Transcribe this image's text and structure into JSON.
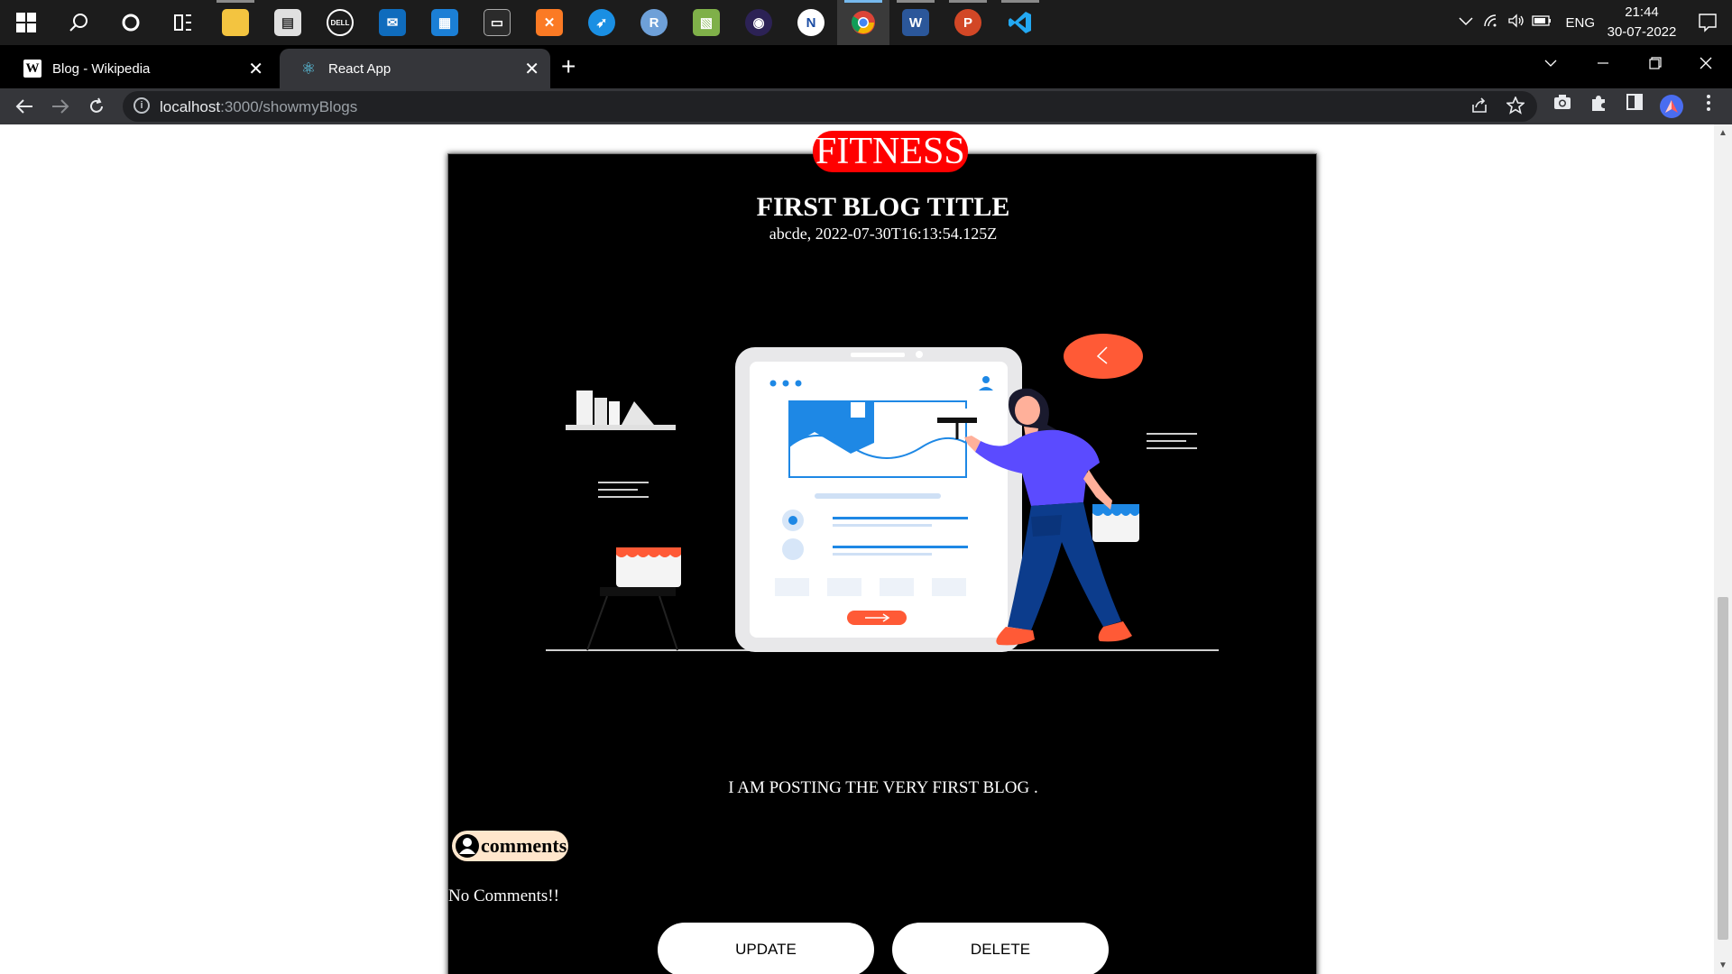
{
  "taskbar": {
    "apps": [
      {
        "name": "start",
        "glyph": "⊞"
      },
      {
        "name": "search",
        "glyph": "⚲"
      },
      {
        "name": "cortana",
        "glyph": "○"
      },
      {
        "name": "task-view",
        "glyph": "⧉"
      },
      {
        "name": "file-explorer",
        "glyph": "▬"
      },
      {
        "name": "document-app",
        "glyph": "▤"
      },
      {
        "name": "dell",
        "glyph": "DELL"
      },
      {
        "name": "mail",
        "glyph": "✉"
      },
      {
        "name": "store",
        "glyph": "▦"
      },
      {
        "name": "terminal",
        "glyph": "▭"
      },
      {
        "name": "xampp",
        "glyph": "✕"
      },
      {
        "name": "navigator",
        "glyph": "➶"
      },
      {
        "name": "r-app",
        "glyph": "R"
      },
      {
        "name": "image-app",
        "glyph": "▧"
      },
      {
        "name": "eclipse",
        "glyph": "◉"
      },
      {
        "name": "notes-app",
        "glyph": "N"
      },
      {
        "name": "chrome",
        "glyph": "●"
      },
      {
        "name": "word",
        "glyph": "W"
      },
      {
        "name": "powerpoint",
        "glyph": "P"
      },
      {
        "name": "vscode",
        "glyph": "⟩"
      }
    ],
    "language": "ENG",
    "time": "21:44",
    "date": "30-07-2022"
  },
  "browser": {
    "tabs": [
      {
        "title": "Blog - Wikipedia",
        "icon": "W"
      },
      {
        "title": "React App",
        "icon": "⚛"
      }
    ],
    "new_tab": "+",
    "url_host": "localhost",
    "url_rest": ":3000/showmyBlogs"
  },
  "post": {
    "category": "FITNESS",
    "title": "FIRST BLOG TITLE",
    "meta": "abcde, 2022-07-30T16:13:54.125Z",
    "body": "I AM POSTING THE VERY FIRST BLOG .",
    "comments_label": "comments",
    "no_comments": "No Comments!!",
    "update_label": "UPDATE",
    "delete_label": "DELETE"
  },
  "colors": {
    "category_bg": "#ff0000",
    "comments_bg": "#ffe6cc",
    "card_bg": "#000000",
    "accent_blue": "#1e88e5",
    "accent_orange": "#ff5a36",
    "person_shirt": "#5b4bff",
    "person_pants": "#0c3c8c"
  }
}
